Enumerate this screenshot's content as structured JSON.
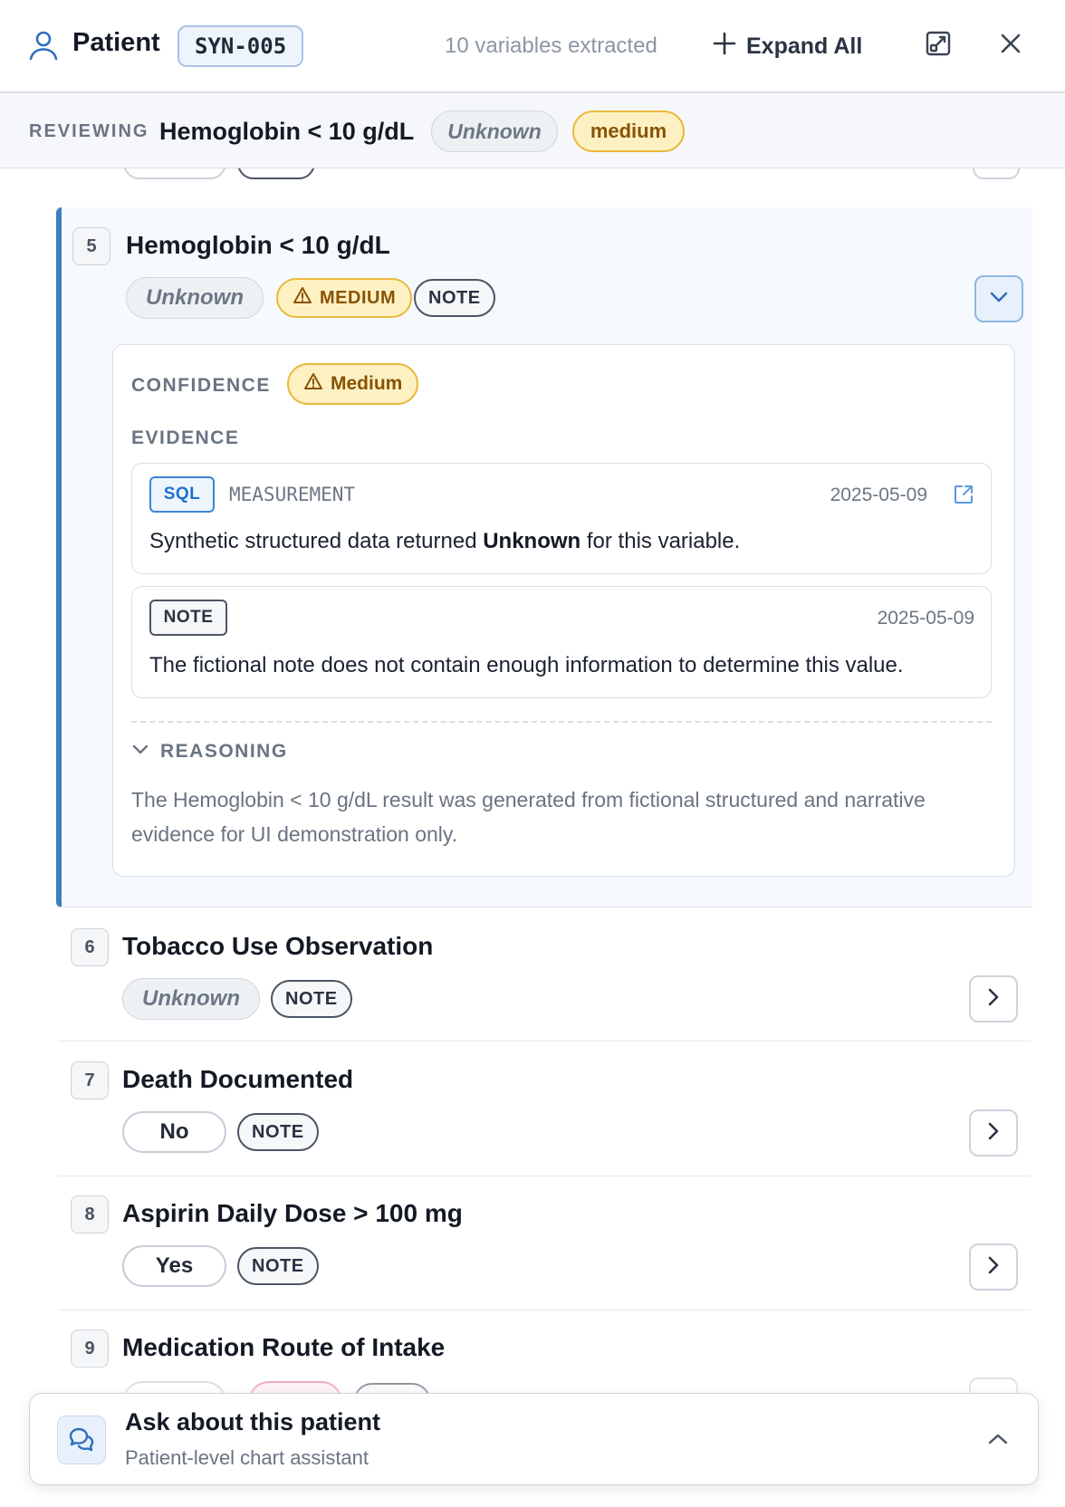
{
  "header": {
    "title": "Patient",
    "patient_id": "SYN-005",
    "count_text": "10 variables extracted",
    "expand_label": "Expand All"
  },
  "reviewing": {
    "label": "REVIEWING",
    "name": "Hemoglobin < 10 g/dL",
    "value": "Unknown",
    "confidence": "medium"
  },
  "variables": [
    {
      "num": "5",
      "title": "Hemoglobin < 10 g/dL",
      "value": "Unknown",
      "confidence": "MEDIUM",
      "source": "NOTE"
    },
    {
      "num": "6",
      "title": "Tobacco Use Observation",
      "value": "Unknown",
      "source": "NOTE"
    },
    {
      "num": "7",
      "title": "Death Documented",
      "value": "No",
      "source": "NOTE"
    },
    {
      "num": "8",
      "title": "Aspirin Daily Dose > 100 mg",
      "value": "Yes",
      "source": "NOTE"
    },
    {
      "num": "9",
      "title": "Medication Route of Intake"
    }
  ],
  "detail": {
    "confidence_label": "CONFIDENCE",
    "confidence_value": "Medium",
    "evidence_label": "EVIDENCE",
    "evidence": [
      {
        "type": "SQL",
        "source": "MEASUREMENT",
        "date": "2025-05-09",
        "text_pre": "Synthetic structured data returned ",
        "text_bold": "Unknown",
        "text_post": " for this variable."
      },
      {
        "type": "NOTE",
        "date": "2025-05-09",
        "text": "The fictional note does not contain enough information to determine this value."
      }
    ],
    "reasoning_label": "REASONING",
    "reasoning_text": "The Hemoglobin < 10 g/dL result was generated from fictional structured and narrative evidence for UI demonstration only."
  },
  "assistant": {
    "title": "Ask about this patient",
    "subtitle": "Patient-level chart assistant"
  },
  "colors": {
    "accent": "#3d7fc1",
    "medium_bg": "#fdf1c4",
    "medium_border": "#e9b93c",
    "medium_text": "#8a5200",
    "sql_blue": "#1f6fd0"
  },
  "icons": [
    "person-icon",
    "plus-icon",
    "open-in-new-window-icon",
    "close-icon",
    "chevron-down-icon",
    "warning-icon",
    "external-link-icon",
    "chevron-right-icon",
    "chat-bubbles-icon",
    "chevron-up-icon"
  ]
}
